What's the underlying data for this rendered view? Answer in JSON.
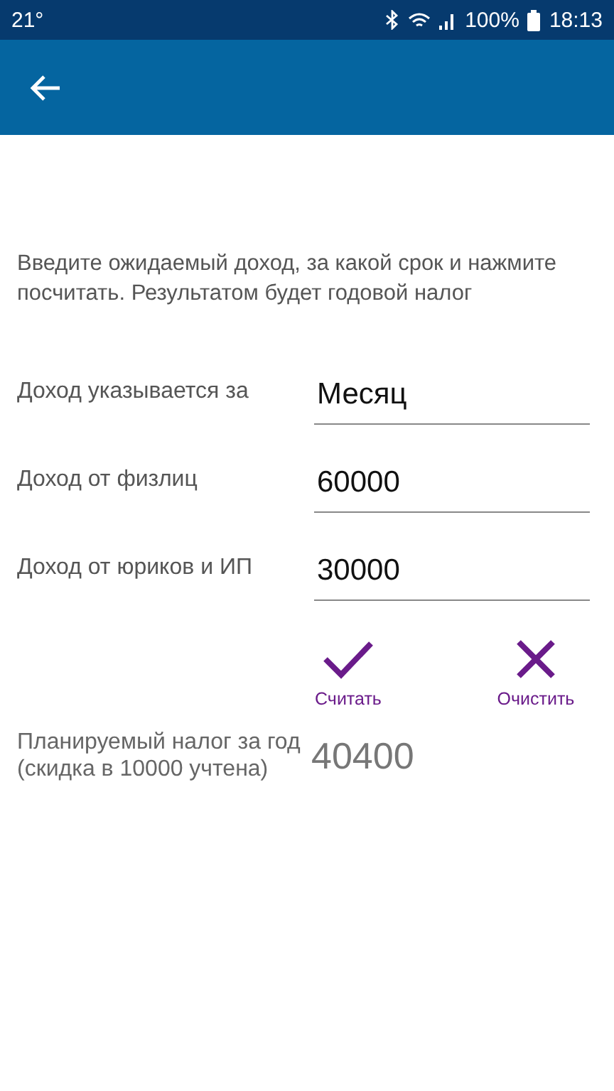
{
  "status_bar": {
    "temperature": "21°",
    "battery": "100%",
    "time": "18:13"
  },
  "intro": "Введите ожидаемый доход, за какой срок и нажмите посчитать. Результатом будет годовой налог",
  "fields": [
    {
      "label": "Доход указывается за",
      "value": "Месяц"
    },
    {
      "label": "Доход от физлиц",
      "value": "60000"
    },
    {
      "label": "Доход от юриков и ИП",
      "value": "30000"
    }
  ],
  "actions": [
    {
      "kind": "check",
      "label": "Считать"
    },
    {
      "kind": "clear",
      "label": "Очистить"
    }
  ],
  "result": {
    "label": "Планируемый налог за год (скидка в 10000 учтена)",
    "value": "40400"
  }
}
